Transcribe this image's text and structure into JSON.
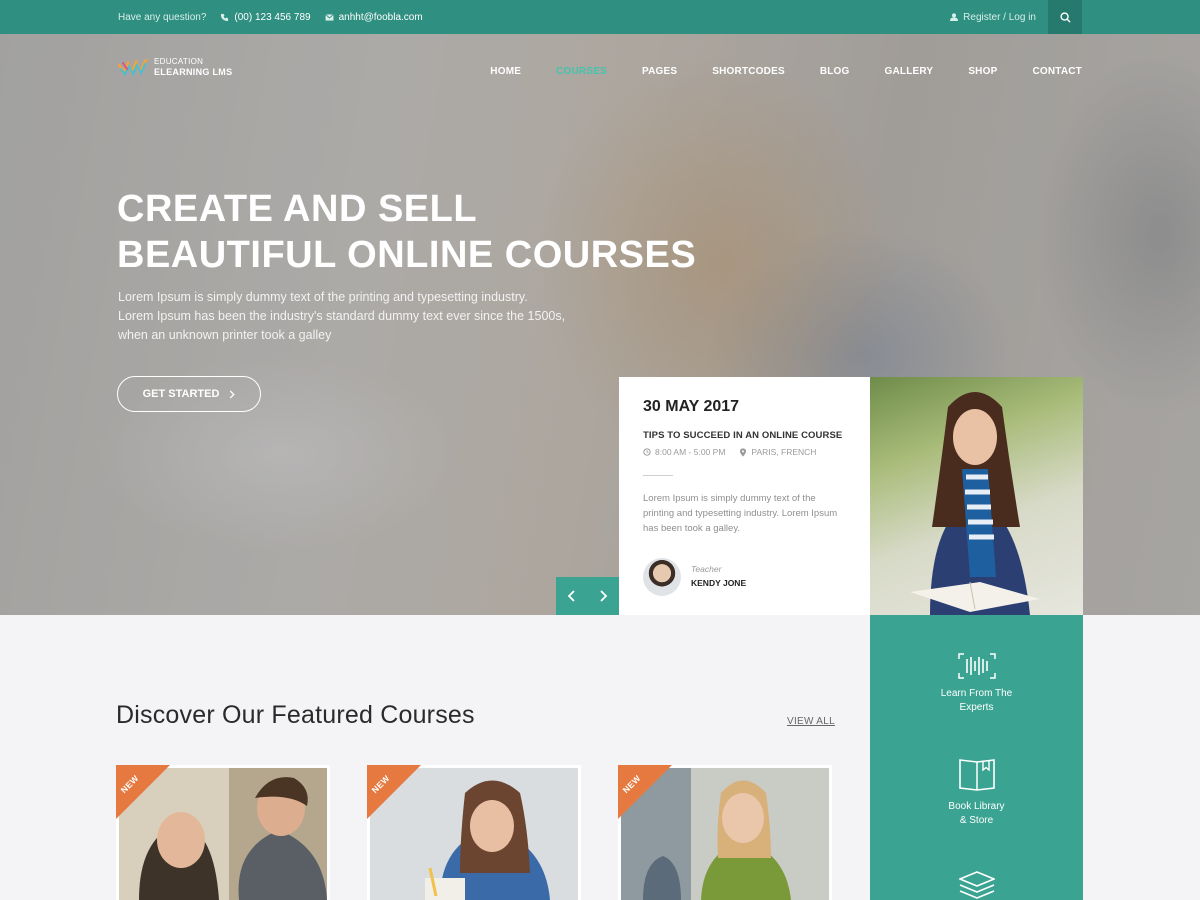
{
  "topbar": {
    "question": "Have any question?",
    "phone": "(00) 123 456 789",
    "email": "anhht@foobla.com",
    "auth": "Register / Log in"
  },
  "logo": {
    "line1": "EDUCATION",
    "line2": "ELEARNING LMS"
  },
  "nav": {
    "items": [
      "HOME",
      "COURSES",
      "PAGES",
      "SHORTCODES",
      "BLOG",
      "GALLERY",
      "SHOP",
      "CONTACT"
    ],
    "active": "COURSES"
  },
  "hero": {
    "title_line1": "CREATE AND SELL",
    "title_line2": "BEAUTIFUL ONLINE COURSES",
    "desc_line1": "Lorem Ipsum is simply dummy text of the printing and typesetting industry.",
    "desc_line2": "Lorem Ipsum has been the industry's standard dummy text ever since the 1500s,",
    "desc_line3": "when an unknown printer took a galley",
    "cta": "GET STARTED"
  },
  "event": {
    "date": "30 MAY 2017",
    "title": "TIPS TO SUCCEED IN AN ONLINE COURSE",
    "time": "8:00 AM - 5:00 PM",
    "location": "PARIS, FRENCH",
    "description": "Lorem Ipsum is simply dummy text of the printing and typesetting industry. Lorem Ipsum has been took a galley.",
    "teacher_role": "Teacher",
    "teacher_name": "KENDY JONE"
  },
  "features": {
    "item1": {
      "line1": "Learn From The",
      "line2": "Experts"
    },
    "item2": {
      "line1": "Book Library",
      "line2": "& Store"
    }
  },
  "featured": {
    "title": "Discover Our Featured Courses",
    "view_all": "VIEW ALL",
    "badge": "NEW"
  },
  "colors": {
    "primary": "#3aa391",
    "topbar": "#2f8f80",
    "accent_nav": "#43c4ad",
    "ribbon": "#e5793f"
  }
}
